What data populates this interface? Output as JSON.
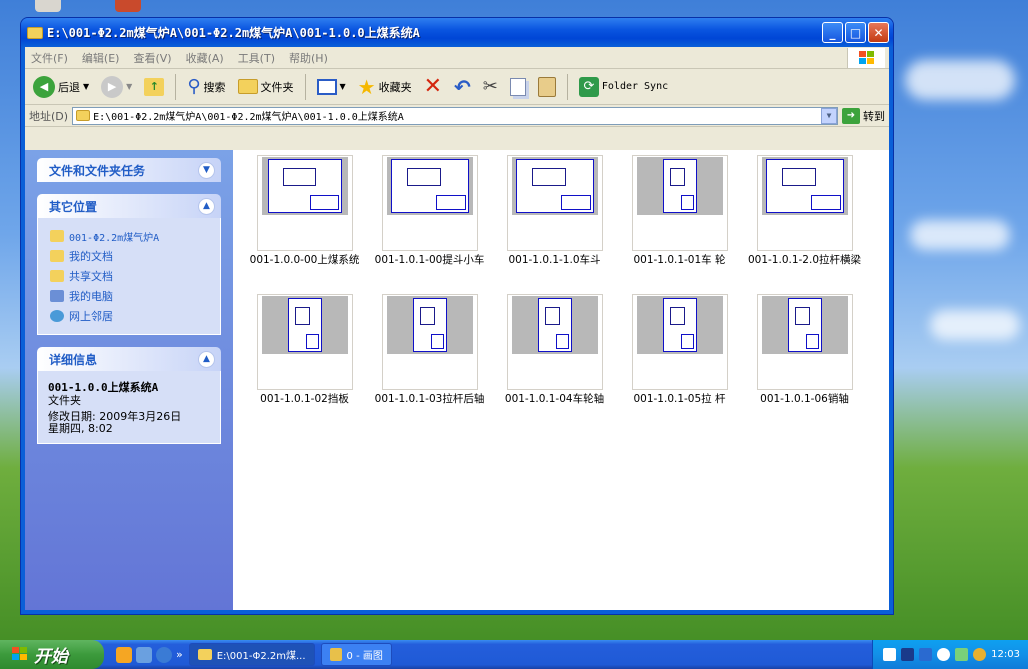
{
  "window": {
    "title": "E:\\001-Φ2.2m煤气炉A\\001-Φ2.2m煤气炉A\\001-1.0.0上煤系统A",
    "minimize": "_",
    "maximize": "□",
    "close": "✕"
  },
  "menu": [
    "文件(F)",
    "编辑(E)",
    "查看(V)",
    "收藏(A)",
    "工具(T)",
    "帮助(H)"
  ],
  "toolbar": {
    "back": "后退",
    "search": "搜索",
    "folders": "文件夹",
    "favorites": "收藏夹",
    "sync": "Folder Sync"
  },
  "address": {
    "label": "地址(D)",
    "path": "E:\\001-Φ2.2m煤气炉A\\001-Φ2.2m煤气炉A\\001-1.0.0上煤系统A",
    "go": "转到"
  },
  "sidebar": {
    "tasks_title": "文件和文件夹任务",
    "places_title": "其它位置",
    "places": [
      {
        "label": "001-Φ2.2m煤气炉A",
        "icon": "folder-icon",
        "color": "#f3d15c"
      },
      {
        "label": "我的文档",
        "icon": "documents-icon",
        "color": "#f3d15c"
      },
      {
        "label": "共享文档",
        "icon": "shared-folder-icon",
        "color": "#f3d15c"
      },
      {
        "label": "我的电脑",
        "icon": "computer-icon",
        "color": "#6b8fd6"
      },
      {
        "label": "网上邻居",
        "icon": "network-icon",
        "color": "#4a9ad8"
      }
    ],
    "details_title": "详细信息",
    "details": {
      "name": "001-1.0.0上煤系统A",
      "type": "文件夹",
      "modified_line1": "修改日期: 2009年3月26日",
      "modified_line2": "星期四, 8:02"
    }
  },
  "files": [
    {
      "name": "001-1.0.0-00上煤系统"
    },
    {
      "name": "001-1.0.1-00提斗小车"
    },
    {
      "name": "001-1.0.1-1.0车斗"
    },
    {
      "name": "001-1.0.1-01车 轮"
    },
    {
      "name": "001-1.0.1-2.0拉杆横梁"
    },
    {
      "name": "001-1.0.1-02挡板"
    },
    {
      "name": "001-1.0.1-03拉杆后轴"
    },
    {
      "name": "001-1.0.1-04车轮轴"
    },
    {
      "name": "001-1.0.1-05拉 杆"
    },
    {
      "name": "001-1.0.1-06销轴"
    }
  ],
  "taskbar": {
    "start": "开始",
    "more": "»",
    "tasks": [
      {
        "label": "E:\\001-Φ2.2m煤...",
        "active": true
      },
      {
        "label": "0 - 画图",
        "active": false
      }
    ],
    "clock": "12:03"
  }
}
